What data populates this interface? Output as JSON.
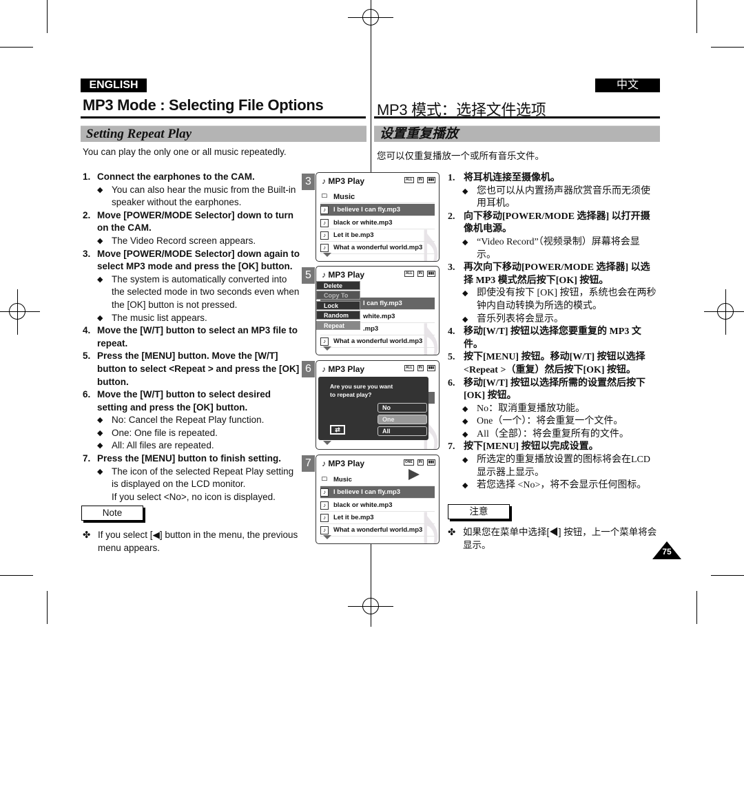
{
  "header": {
    "lang_en": "ENGLISH",
    "lang_zh": "中文",
    "title_en": "MP3 Mode : Selecting File Options",
    "title_zh": "MP3 模式：选择文件选项"
  },
  "section": {
    "title_en": "Setting Repeat Play",
    "title_zh": "设置重复播放",
    "intro_en": "You can play the only one or all music repeatedly.",
    "intro_zh": "您可以仅重复播放一个或所有音乐文件。"
  },
  "steps_en": [
    {
      "n": "1.",
      "text": "Connect the earphones to the CAM.",
      "bullets": [
        "You can also hear the music from the Built-in speaker without the earphones."
      ]
    },
    {
      "n": "2.",
      "text": "Move [POWER/MODE Selector] down to turn on the CAM.",
      "bullets": [
        "The Video Record screen appears."
      ]
    },
    {
      "n": "3.",
      "text": "Move [POWER/MODE Selector] down again to select MP3 mode and press the [OK] button.",
      "bullets": [
        "The system is automatically converted into the selected mode in two seconds even when the [OK] button is not pressed.",
        "The music list appears."
      ]
    },
    {
      "n": "4.",
      "text": "Move the [W/T] button to select an MP3 file to repeat.",
      "bullets": []
    },
    {
      "n": "5.",
      "text": "Press the [MENU] button. Move the [W/T] button to select <Repeat > and press the [OK] button.",
      "bullets": []
    },
    {
      "n": "6.",
      "text": "Move the [W/T] button to select desired setting and press the [OK] button.",
      "bullets": [
        "No: Cancel the Repeat Play function.",
        "One: One file is repeated.",
        "All: All files are repeated."
      ]
    },
    {
      "n": "7.",
      "text": "Press the [MENU] button to finish setting.",
      "bullets": [
        "The icon of the selected Repeat Play setting is displayed on the LCD monitor."
      ],
      "extra": "If you select <No>, no icon is displayed."
    }
  ],
  "steps_zh": [
    {
      "n": "1.",
      "text": "将耳机连接至摄像机。",
      "bullets": [
        "您也可以从内置扬声器欣赏音乐而无须使用耳机。"
      ]
    },
    {
      "n": "2.",
      "text": "向下移动[POWER/MODE 选择器] 以打开摄像机电源。",
      "bullets": [
        "“Video Record”（视频录制）屏幕将会显示。"
      ]
    },
    {
      "n": "3.",
      "text": "再次向下移动[POWER/MODE 选择器] 以选择 MP3 模式然后按下[OK] 按钮。",
      "bullets": [
        "即使没有按下 [OK] 按钮，系统也会在两秒钟内自动转换为所选的模式。",
        "音乐列表将会显示。"
      ]
    },
    {
      "n": "4.",
      "text": "移动[W/T] 按钮以选择您要重复的 MP3 文件。",
      "bullets": []
    },
    {
      "n": "5.",
      "text": "按下[MENU] 按钮。移动[W/T] 按钮以选择<Repeat >（重复）然后按下[OK] 按钮。",
      "bullets": []
    },
    {
      "n": "6.",
      "text": "移动[W/T] 按钮以选择所需的设置然后按下[OK] 按钮。",
      "bullets": [
        "No：取消重复播放功能。",
        "One（一个）：将会重复一个文件。",
        "All（全部）：将会重复所有的文件。"
      ]
    },
    {
      "n": "7.",
      "text": "按下[MENU] 按钮以完成设置。",
      "bullets": [
        "所选定的重复播放设置的图标将会在LCD 显示器上显示。",
        "若您选择 <No>，将不会显示任何图标。"
      ]
    }
  ],
  "note": {
    "label_en": "Note",
    "label_zh": "注意",
    "text_en": "If you select [◀] button in the menu, the previous menu appears.",
    "text_zh": "如果您在菜单中选择[◀] 按钮，上一个菜单将会显示。"
  },
  "screens": {
    "title": "MP3 Play",
    "folder": "Music",
    "files": [
      "I believe I can fly.mp3",
      "black or white.mp3",
      "Let it be.mp3",
      "What a wonderful world.mp3"
    ],
    "step_numbers": [
      "3",
      "5",
      "6",
      "7"
    ],
    "menu": [
      "Delete",
      "Copy To",
      "Lock",
      "Random",
      "Repeat"
    ],
    "screen5_files": [
      "I can fly.mp3",
      "white.mp3",
      ".mp3",
      "What a wonderful world.mp3"
    ],
    "dialog": {
      "question_l1": "Are you sure you want",
      "question_l2": "to repeat play?",
      "options": [
        "No",
        "One",
        "All"
      ]
    },
    "status_icons": [
      "repeat-all-icon",
      "card-icon",
      "battery-icon"
    ],
    "status_labels": {
      "all": "ALL",
      "one": "ONE",
      "card": "IN"
    }
  },
  "page_number": "75"
}
